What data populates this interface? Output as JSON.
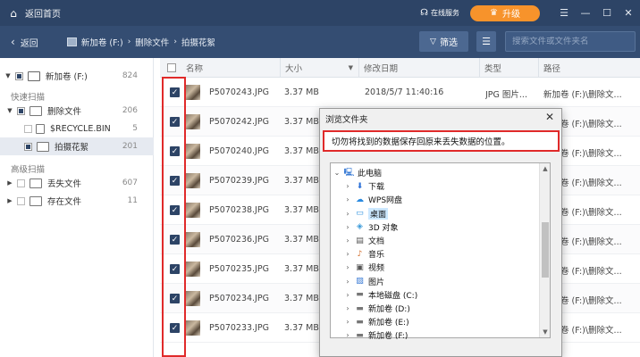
{
  "titlebar": {
    "home_label": "返回首页",
    "service_label": "在线服务",
    "upgrade_label": "升级",
    "minimize_icon": "minimize-icon",
    "maximize_icon": "maximize-icon",
    "close_icon": "close-icon"
  },
  "navbar": {
    "back_label": "返回",
    "breadcrumb": [
      "新加卷 (F:)",
      "删除文件",
      "拍摄花絮"
    ],
    "filter_label": "筛选",
    "search_placeholder": "搜索文件或文件夹名"
  },
  "sidebar": {
    "root": {
      "label": "新加卷 (F:)",
      "count": "824"
    },
    "quick_scan_label": "快速扫描",
    "quick_items": [
      {
        "label": "删除文件",
        "count": "206"
      },
      {
        "label": "$RECYCLE.BIN",
        "count": "5"
      },
      {
        "label": "拍摄花絮",
        "count": "201"
      }
    ],
    "advanced_scan_label": "高级扫描",
    "advanced_items": [
      {
        "label": "丢失文件",
        "count": "607"
      },
      {
        "label": "存在文件",
        "count": "11"
      }
    ]
  },
  "list": {
    "headers": {
      "name": "名称",
      "size": "大小",
      "modified": "修改日期",
      "type": "类型",
      "path": "路径"
    },
    "rows": [
      {
        "name": "P5070243.JPG",
        "size": "3.37 MB",
        "modified": "2018/5/7 11:40:16",
        "type": "JPG 图片...",
        "path": "新加卷 (F:)\\删除文..."
      },
      {
        "name": "P5070242.JPG",
        "size": "3.37 MB",
        "modified": "",
        "type": "",
        "path": "新加卷 (F:)\\删除文..."
      },
      {
        "name": "P5070240.JPG",
        "size": "3.37 MB",
        "modified": "",
        "type": "",
        "path": "新加卷 (F:)\\删除文..."
      },
      {
        "name": "P5070239.JPG",
        "size": "3.37 MB",
        "modified": "",
        "type": "",
        "path": "新加卷 (F:)\\删除文..."
      },
      {
        "name": "P5070238.JPG",
        "size": "3.37 MB",
        "modified": "",
        "type": "",
        "path": "新加卷 (F:)\\删除文..."
      },
      {
        "name": "P5070236.JPG",
        "size": "3.37 MB",
        "modified": "",
        "type": "",
        "path": "新加卷 (F:)\\删除文..."
      },
      {
        "name": "P5070235.JPG",
        "size": "3.37 MB",
        "modified": "",
        "type": "",
        "path": "新加卷 (F:)\\删除文..."
      },
      {
        "name": "P5070234.JPG",
        "size": "3.37 MB",
        "modified": "",
        "type": "",
        "path": "新加卷 (F:)\\删除文..."
      },
      {
        "name": "P5070233.JPG",
        "size": "3.37 MB",
        "modified": "",
        "type": "",
        "path": "新加卷 (F:)\\删除文..."
      }
    ]
  },
  "dialog": {
    "title": "浏览文件夹",
    "message": "切勿将找到的数据保存回原来丢失数据的位置。",
    "tree": [
      {
        "label": "此电脑",
        "icon": "computer-icon"
      },
      {
        "label": "下载",
        "icon": "download-icon"
      },
      {
        "label": "WPS网盘",
        "icon": "cloud-icon"
      },
      {
        "label": "桌面",
        "icon": "desktop-icon"
      },
      {
        "label": "3D 对象",
        "icon": "cube-icon"
      },
      {
        "label": "文档",
        "icon": "document-icon"
      },
      {
        "label": "音乐",
        "icon": "music-icon"
      },
      {
        "label": "视频",
        "icon": "video-icon"
      },
      {
        "label": "图片",
        "icon": "picture-icon"
      },
      {
        "label": "本地磁盘 (C:)",
        "icon": "drive-icon"
      },
      {
        "label": "新加卷 (D:)",
        "icon": "drive-icon"
      },
      {
        "label": "新加卷 (E:)",
        "icon": "drive-icon"
      },
      {
        "label": "新加卷 (F:)",
        "icon": "drive-icon"
      }
    ]
  },
  "colors": {
    "titlebar": "#2d4466",
    "navbar": "#344d72",
    "accent": "#f7932b",
    "highlight": "#e02a2a"
  }
}
